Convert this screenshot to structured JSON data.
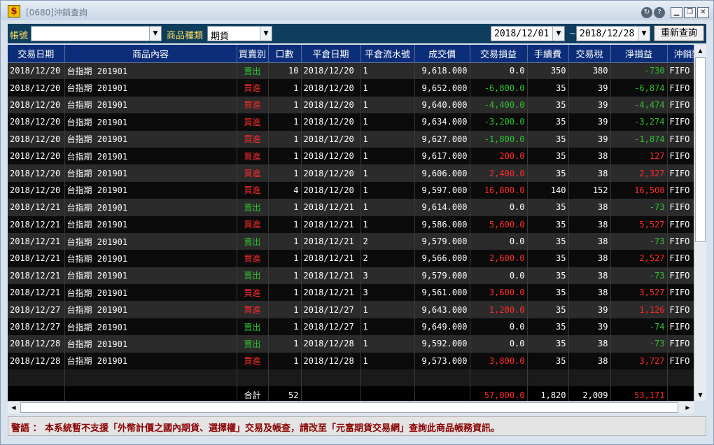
{
  "window": {
    "title": "[0680]沖銷查詢",
    "app_icon_glyph": "$",
    "controls": {
      "restore": "↻",
      "help": "?",
      "minimize": "▁",
      "maximize": "❐",
      "close": "✕"
    }
  },
  "toolbar": {
    "account_label": "帳號",
    "account_value": "",
    "product_type_label": "商品種類",
    "product_type_value": "期貨",
    "date_from": "2018/12/01",
    "date_separator": "~",
    "date_to": "2018/12/28",
    "requery_label": "重新查詢",
    "dropdown_arrow": "▼"
  },
  "table": {
    "columns": [
      "交易日期",
      "商品內容",
      "買賣別",
      "口數",
      "平倉日期",
      "平倉流水號",
      "成交價",
      "交易損益",
      "手續費",
      "交易稅",
      "淨損益",
      "沖銷類"
    ],
    "rows": [
      [
        "2018/12/20",
        "台指期  201901",
        "賣出",
        "10",
        "2018/12/20",
        "1",
        "9,618.000",
        "0.0",
        "350",
        "380",
        "-730",
        "FIFO"
      ],
      [
        "2018/12/20",
        "台指期  201901",
        "買進",
        "1",
        "2018/12/20",
        "1",
        "9,652.000",
        "-6,800.0",
        "35",
        "39",
        "-6,874",
        "FIFO"
      ],
      [
        "2018/12/20",
        "台指期  201901",
        "買進",
        "1",
        "2018/12/20",
        "1",
        "9,640.000",
        "-4,400.0",
        "35",
        "39",
        "-4,474",
        "FIFO"
      ],
      [
        "2018/12/20",
        "台指期  201901",
        "買進",
        "1",
        "2018/12/20",
        "1",
        "9,634.000",
        "-3,200.0",
        "35",
        "39",
        "-3,274",
        "FIFO"
      ],
      [
        "2018/12/20",
        "台指期  201901",
        "買進",
        "1",
        "2018/12/20",
        "1",
        "9,627.000",
        "-1,800.0",
        "35",
        "39",
        "-1,874",
        "FIFO"
      ],
      [
        "2018/12/20",
        "台指期  201901",
        "買進",
        "1",
        "2018/12/20",
        "1",
        "9,617.000",
        "200.0",
        "35",
        "38",
        "127",
        "FIFO"
      ],
      [
        "2018/12/20",
        "台指期  201901",
        "買進",
        "1",
        "2018/12/20",
        "1",
        "9,606.000",
        "2,400.0",
        "35",
        "38",
        "2,327",
        "FIFO"
      ],
      [
        "2018/12/20",
        "台指期  201901",
        "買進",
        "4",
        "2018/12/20",
        "1",
        "9,597.000",
        "16,800.0",
        "140",
        "152",
        "16,508",
        "FIFO"
      ],
      [
        "2018/12/21",
        "台指期  201901",
        "賣出",
        "1",
        "2018/12/21",
        "1",
        "9,614.000",
        "0.0",
        "35",
        "38",
        "-73",
        "FIFO"
      ],
      [
        "2018/12/21",
        "台指期  201901",
        "買進",
        "1",
        "2018/12/21",
        "1",
        "9,586.000",
        "5,600.0",
        "35",
        "38",
        "5,527",
        "FIFO"
      ],
      [
        "2018/12/21",
        "台指期  201901",
        "賣出",
        "1",
        "2018/12/21",
        "2",
        "9,579.000",
        "0.0",
        "35",
        "38",
        "-73",
        "FIFO"
      ],
      [
        "2018/12/21",
        "台指期  201901",
        "買進",
        "1",
        "2018/12/21",
        "2",
        "9,566.000",
        "2,600.0",
        "35",
        "38",
        "2,527",
        "FIFO"
      ],
      [
        "2018/12/21",
        "台指期  201901",
        "賣出",
        "1",
        "2018/12/21",
        "3",
        "9,579.000",
        "0.0",
        "35",
        "38",
        "-73",
        "FIFO"
      ],
      [
        "2018/12/21",
        "台指期  201901",
        "買進",
        "1",
        "2018/12/21",
        "3",
        "9,561.000",
        "3,600.0",
        "35",
        "38",
        "3,527",
        "FIFO"
      ],
      [
        "2018/12/27",
        "台指期  201901",
        "買進",
        "1",
        "2018/12/27",
        "1",
        "9,643.000",
        "1,200.0",
        "35",
        "39",
        "1,126",
        "FIFO"
      ],
      [
        "2018/12/27",
        "台指期  201901",
        "賣出",
        "1",
        "2018/12/27",
        "1",
        "9,649.000",
        "0.0",
        "35",
        "39",
        "-74",
        "FIFO"
      ],
      [
        "2018/12/28",
        "台指期  201901",
        "賣出",
        "1",
        "2018/12/28",
        "1",
        "9,592.000",
        "0.0",
        "35",
        "38",
        "-73",
        "FIFO"
      ],
      [
        "2018/12/28",
        "台指期  201901",
        "買進",
        "1",
        "2018/12/28",
        "1",
        "9,573.000",
        "3,800.0",
        "35",
        "38",
        "3,727",
        "FIFO"
      ]
    ],
    "total": {
      "label": "合計",
      "lots": "52",
      "trade_pl": "57,000.0",
      "fee": "1,820",
      "tax": "2,009",
      "net_pl": "53,171"
    }
  },
  "scrollbars": {
    "up": "▲",
    "down": "▼",
    "left": "◀",
    "right": "▶"
  },
  "warning": "警語 ： 本系統暫不支援「外幣計價之國內期貨、選擇權」交易及帳查，請改至「元富期貨交易網」查詢此商品帳務資訊。",
  "colors": {
    "buy": "#ff2a2a",
    "sell": "#2fc12f",
    "loss": "#2fc12f",
    "profit": "#ff2a2a",
    "header_bg": "#0c2e7a",
    "toolbar_bg": "#0e3d5e"
  }
}
